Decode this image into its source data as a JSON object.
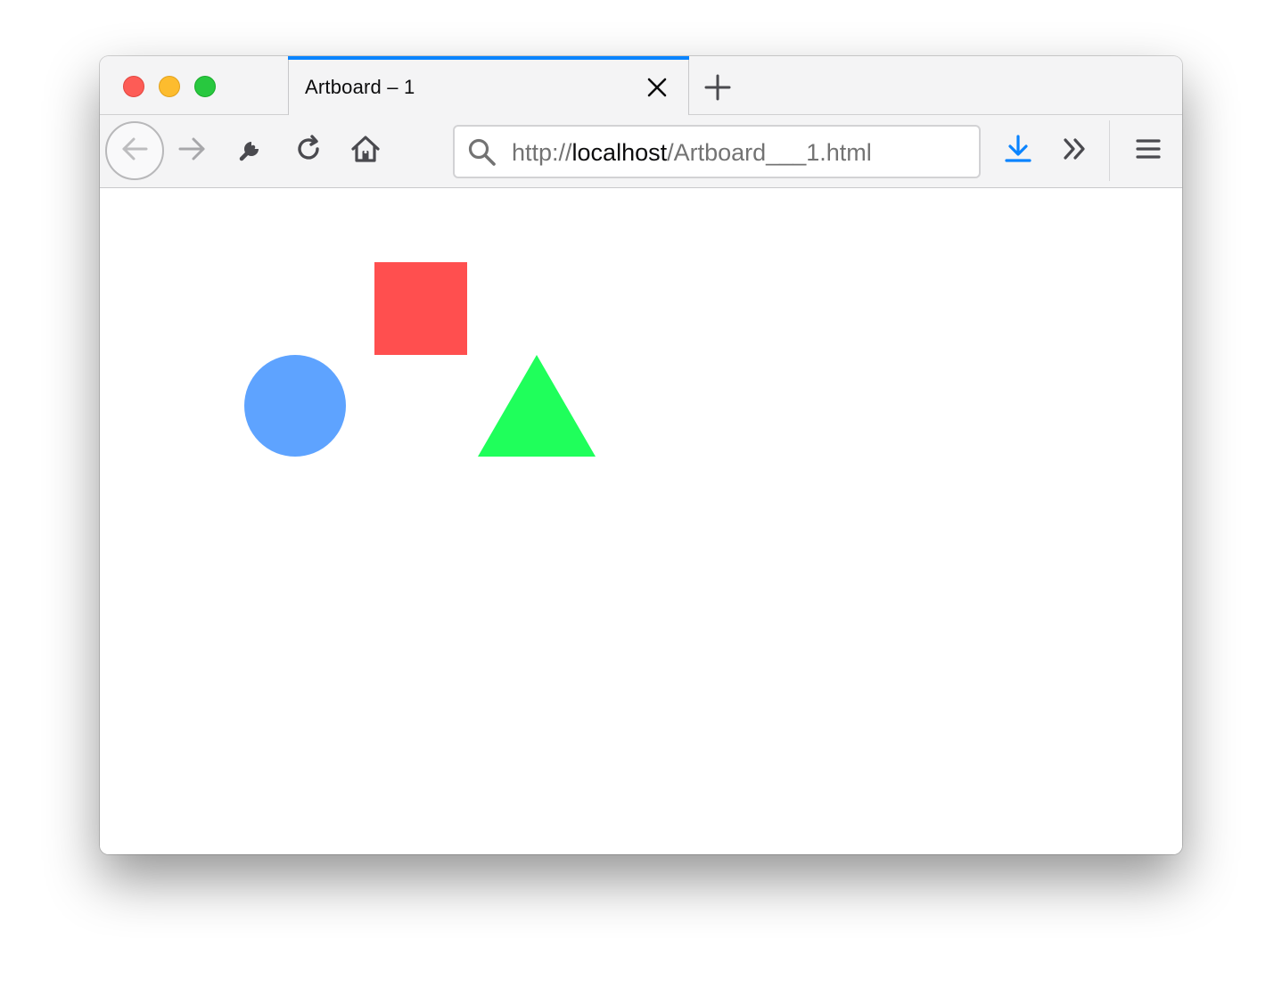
{
  "window": {
    "traffic_lights": [
      {
        "name": "close",
        "color": "#fd5c56"
      },
      {
        "name": "minimize",
        "color": "#fdbc2e"
      },
      {
        "name": "zoom",
        "color": "#28c83f"
      }
    ]
  },
  "tabbar": {
    "active_tab": {
      "title": "Artboard – 1",
      "close_icon": "close-icon",
      "accent_color": "#0a84ff"
    },
    "new_tab_icon": "plus-icon"
  },
  "navbar": {
    "back_icon": "arrow-left-icon",
    "forward_icon": "arrow-right-icon",
    "tools_icon": "wrench-icon",
    "reload_icon": "reload-icon",
    "home_icon": "home-icon",
    "url": {
      "prefix": "http://",
      "host": "localhost",
      "path": "/Artboard___1.html"
    },
    "download_icon": "download-icon",
    "download_color": "#0a84ff",
    "overflow_icon": "double-chevron-right-icon",
    "menu_icon": "hamburger-menu-icon"
  },
  "content": {
    "shapes": [
      {
        "type": "square",
        "color": "#ff4f4f"
      },
      {
        "type": "circle",
        "color": "#5ea3ff"
      },
      {
        "type": "triangle",
        "color": "#1fff5b"
      }
    ]
  }
}
